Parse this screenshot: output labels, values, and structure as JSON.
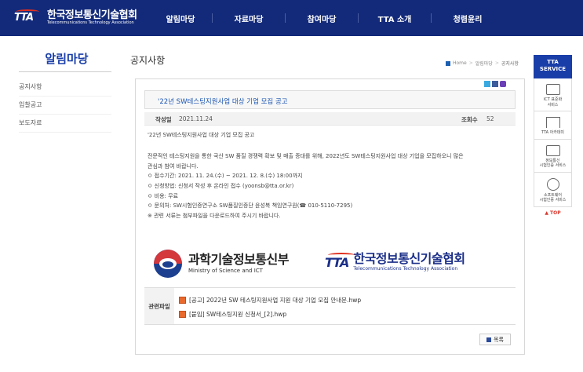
{
  "header": {
    "logo_mark": "TTA",
    "logo_ko": "한국정보통신기술협회",
    "logo_en": "Telecommunications Technology Association",
    "nav": [
      "알림마당",
      "자료마당",
      "참여마당",
      "TTA 소개",
      "청렴윤리"
    ]
  },
  "sidebar": {
    "title": "알림마당",
    "items": [
      "공지사항",
      "입찰공고",
      "보도자료"
    ]
  },
  "content": {
    "page_title": "공지사항",
    "breadcrumb": {
      "home": "Home",
      "section": "알림마당",
      "current": "공지사항"
    },
    "post_title": "'22년 SW테스팅지원사업 대상 기업 모집 공고",
    "date_label": "작성일",
    "date": "2021.11.24",
    "views_label": "조회수",
    "views": "52",
    "body": [
      "'22년 SW테스팅지원사업 대상 기업 모집 공고",
      "",
      "전문적인 테스팅지원을 통한 국산 SW 품질 경쟁력 확보 및 매출 증대를 위해, 2022년도 SW테스팅지원사업 대상 기업을 모집하오니 많은",
      "관심과 참여 바랍니다.",
      "ㅇ 접수기간: 2021. 11. 24.(수) ~ 2021. 12. 8.(수) 18:00까지",
      "ㅇ 신청방법: 신청서 작성 후 온라인 접수 (yoonsb@tta.or.kr)",
      "ㅇ 비용: 무료",
      "ㅇ 문의처: SW시험인증연구소 SW품질인증단 윤성복 책임연구원(☎ 010-5110-7295)",
      "※ 관련 서류는 첨부파일을 다운로드하여 주시기 바랍니다."
    ],
    "logo_msit_ko": "과학기술정보통신부",
    "logo_msit_en": "Ministry of Science and ICT",
    "logo_tta_mark": "TTA",
    "logo_tta_ko": "한국정보통신기술협회",
    "logo_tta_en": "Telecommunications Technology Association",
    "attach_label": "관련파일",
    "files": [
      "[공고] 2022년 SW 테스팅지원사업 지원 대상 기업 모집 안내문.hwp",
      "[붙임] SW테스팅지원 신청서_[2].hwp"
    ],
    "list_button": "목록"
  },
  "right_sidebar": {
    "head_line1": "TTA",
    "head_line2": "SERVICE",
    "items": [
      {
        "line1": "ICT 표준화",
        "line2": "서비스",
        "icon": "document-stack-icon"
      },
      {
        "line1": "TTA 아카데미",
        "line2": "",
        "icon": "graduation-cap-icon"
      },
      {
        "line1": "정보통신",
        "line2": "시험인증 서비스",
        "icon": "monitor-check-icon"
      },
      {
        "line1": "소프트웨어",
        "line2": "시험인증 서비스",
        "icon": "magnifier-icon"
      }
    ],
    "top_label": "▲ TOP"
  },
  "colors": {
    "header_bg": "#132a7a",
    "accent": "#1a3ea8",
    "title_link": "#1b55b3"
  }
}
